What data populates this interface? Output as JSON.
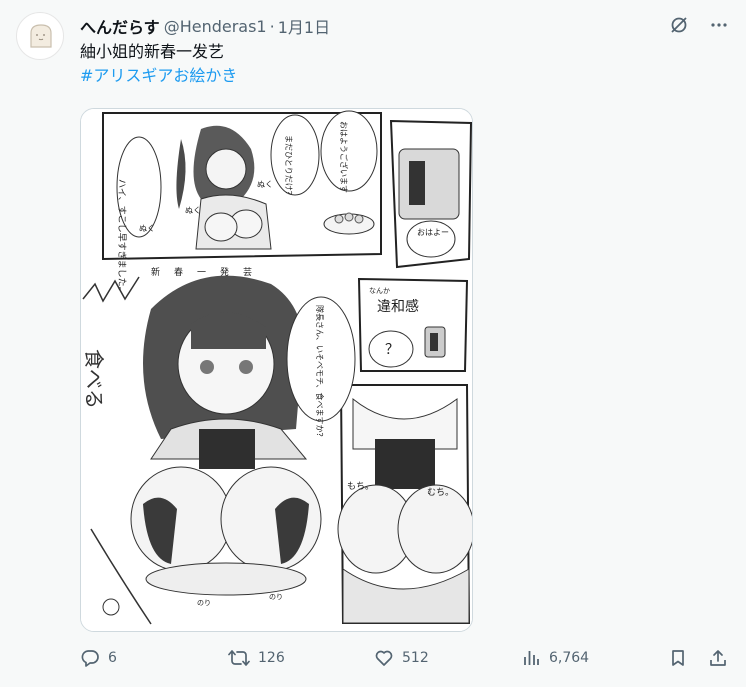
{
  "author": {
    "display_name": "へんだらす",
    "handle": "@Henderas1",
    "separator": "·",
    "date": "1月1日"
  },
  "post": {
    "text": "紬小姐的新春一发艺",
    "hashtag": "#アリスギアお絵かき"
  },
  "media": {
    "speech_1": "ハイ、すこし早すぎました。",
    "speech_2": "まだひとりだけ？",
    "speech_3": "おはようございます",
    "speech_4": "おはよー",
    "sfx_1": "ぬく",
    "sfx_2": "ぬく",
    "sfx_3": "ぬく",
    "banner": "新春一発芸",
    "speech_5": "隊長さん、いそべモチ、食べますか？",
    "big_sfx": "食べる",
    "caption_top": "なんか",
    "caption_main": "違和感",
    "question": "？",
    "sfx_4": "もち。",
    "sfx_5": "むち。",
    "label_1": "のり",
    "label_2": "のり"
  },
  "actions": {
    "replies": "6",
    "reposts": "126",
    "likes": "512",
    "views": "6,764"
  },
  "icons": {
    "top": [
      "grok-icon",
      "more-icon"
    ],
    "actions": [
      "reply-icon",
      "repost-icon",
      "like-icon",
      "views-icon",
      "bookmark-icon",
      "share-icon"
    ]
  },
  "colors": {
    "background": "#f7f9f9",
    "text": "#0f1419",
    "secondary": "#536471",
    "link": "#1d9bf0",
    "border": "#cfd9de"
  }
}
